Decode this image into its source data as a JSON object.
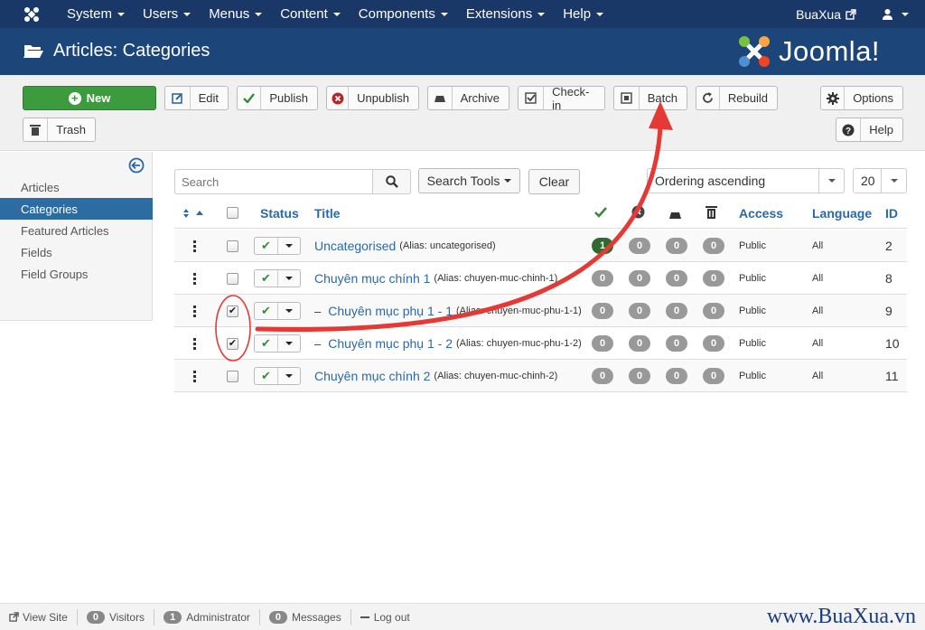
{
  "navbar": {
    "menu": [
      "System",
      "Users",
      "Menus",
      "Content",
      "Components",
      "Extensions",
      "Help"
    ],
    "site_name": "BuaXua"
  },
  "header": {
    "title": "Articles: Categories",
    "brand": "Joomla!"
  },
  "toolbar": {
    "new": "New",
    "edit": "Edit",
    "publish": "Publish",
    "unpublish": "Unpublish",
    "archive": "Archive",
    "checkin": "Check-in",
    "batch": "Batch",
    "rebuild": "Rebuild",
    "options": "Options",
    "trash": "Trash",
    "help": "Help"
  },
  "sidebar": {
    "items": [
      {
        "label": "Articles",
        "active": false
      },
      {
        "label": "Categories",
        "active": true
      },
      {
        "label": "Featured Articles",
        "active": false
      },
      {
        "label": "Fields",
        "active": false
      },
      {
        "label": "Field Groups",
        "active": false
      }
    ]
  },
  "filters": {
    "search_placeholder": "Search",
    "search_tools": "Search Tools",
    "clear": "Clear",
    "ordering": "Ordering ascending",
    "limit": "20"
  },
  "table": {
    "headers": {
      "status": "Status",
      "title": "Title",
      "access": "Access",
      "language": "Language",
      "id": "ID"
    },
    "rows": [
      {
        "prefix": "",
        "title": "Uncategorised",
        "alias": "(Alias: uncategorised)",
        "checked": false,
        "counts": [
          "1",
          "0",
          "0",
          "0"
        ],
        "access": "Public",
        "language": "All",
        "id": "2"
      },
      {
        "prefix": "",
        "title": "Chuyên mục chính 1",
        "alias": "(Alias: chuyen-muc-chinh-1)",
        "checked": false,
        "counts": [
          "0",
          "0",
          "0",
          "0"
        ],
        "access": "Public",
        "language": "All",
        "id": "8"
      },
      {
        "prefix": "–",
        "title": "Chuyên mục phụ 1 - 1",
        "alias": "(Alias: chuyen-muc-phu-1-1)",
        "checked": true,
        "counts": [
          "0",
          "0",
          "0",
          "0"
        ],
        "access": "Public",
        "language": "All",
        "id": "9"
      },
      {
        "prefix": "–",
        "title": "Chuyên mục phụ 1 - 2",
        "alias": "(Alias: chuyen-muc-phu-1-2)",
        "checked": true,
        "counts": [
          "0",
          "0",
          "0",
          "0"
        ],
        "access": "Public",
        "language": "All",
        "id": "10"
      },
      {
        "prefix": "",
        "title": "Chuyên mục chính 2",
        "alias": "(Alias: chuyen-muc-chinh-2)",
        "checked": false,
        "counts": [
          "0",
          "0",
          "0",
          "0"
        ],
        "access": "Public",
        "language": "All",
        "id": "11"
      }
    ]
  },
  "footer": {
    "view_site": "View Site",
    "visitors_count": "0",
    "visitors": "Visitors",
    "admin_count": "1",
    "admin": "Administrator",
    "messages_count": "0",
    "messages": "Messages",
    "logout": "Log out"
  },
  "watermark": "www.BuaXua.vn",
  "colors": {
    "navbar": "#1a3867",
    "header": "#1c4579",
    "new_button": "#3c9b3c",
    "link": "#2a69a8",
    "annotation": "#e53935"
  }
}
